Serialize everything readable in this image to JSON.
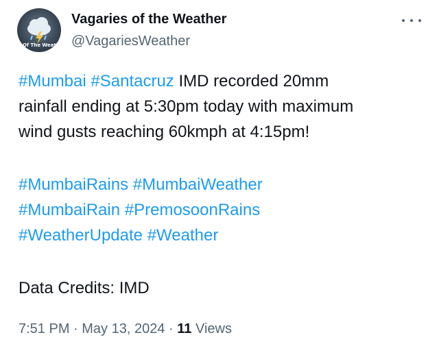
{
  "author": {
    "display_name": "Vagaries of the Weather",
    "handle": "@VagariesWeather",
    "avatar_text": "Of The Weath"
  },
  "tweet": {
    "line1_tag1": "#Mumbai",
    "line1_tag2": "#Santacruz",
    "line1_text": " IMD recorded 20mm",
    "line2": "rainfall ending at 5:30pm today with maximum",
    "line3": "wind gusts reaching 60kmph at 4:15pm!",
    "hashtags_line1": [
      "#MumbaiRains",
      "#MumbaiWeather"
    ],
    "hashtags_line2": [
      "#MumbaiRain",
      "#PremosoonRains"
    ],
    "hashtags_line3": [
      "#WeatherUpdate",
      "#Weather"
    ],
    "credits": "Data Credits: IMD"
  },
  "meta": {
    "time": "7:51 PM",
    "separator": " · ",
    "date": "May 13, 2024",
    "views_count": "11",
    "views_label": " Views"
  },
  "colors": {
    "hashtag": "#1d9bf0",
    "secondary_text": "#536471",
    "primary_text": "#0f1419"
  },
  "icons": {
    "more": "more-horizontal-icon",
    "avatar": "cloud-rain-icon"
  }
}
